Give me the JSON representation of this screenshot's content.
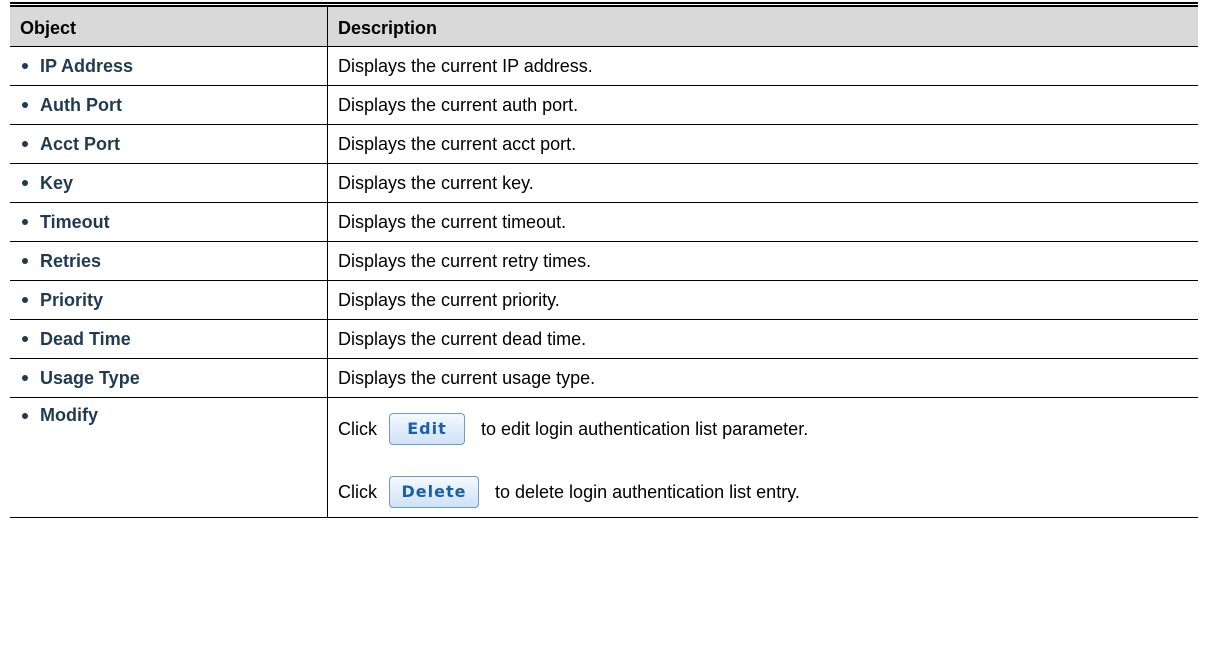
{
  "table": {
    "headers": {
      "object": "Object",
      "description": "Description"
    },
    "rows": [
      {
        "object": "IP Address",
        "description": "Displays the current IP address."
      },
      {
        "object": "Auth Port",
        "description": "Displays the current auth port."
      },
      {
        "object": "Acct Port",
        "description": "Displays the current acct port."
      },
      {
        "object": "Key",
        "description": "Displays the current key."
      },
      {
        "object": "Timeout",
        "description": "Displays the current timeout."
      },
      {
        "object": "Retries",
        "description": "Displays the current retry times."
      },
      {
        "object": "Priority",
        "description": "Displays the current priority."
      },
      {
        "object": "Dead Time",
        "description": "Displays the current dead time."
      },
      {
        "object": "Usage Type",
        "description": "Displays the current usage type."
      }
    ],
    "modify": {
      "object": "Modify",
      "click_label": "Click",
      "edit_button": "Edit",
      "edit_text": "to edit login authentication list parameter.",
      "delete_button": "Delete",
      "delete_text": "to delete login authentication list entry."
    }
  }
}
